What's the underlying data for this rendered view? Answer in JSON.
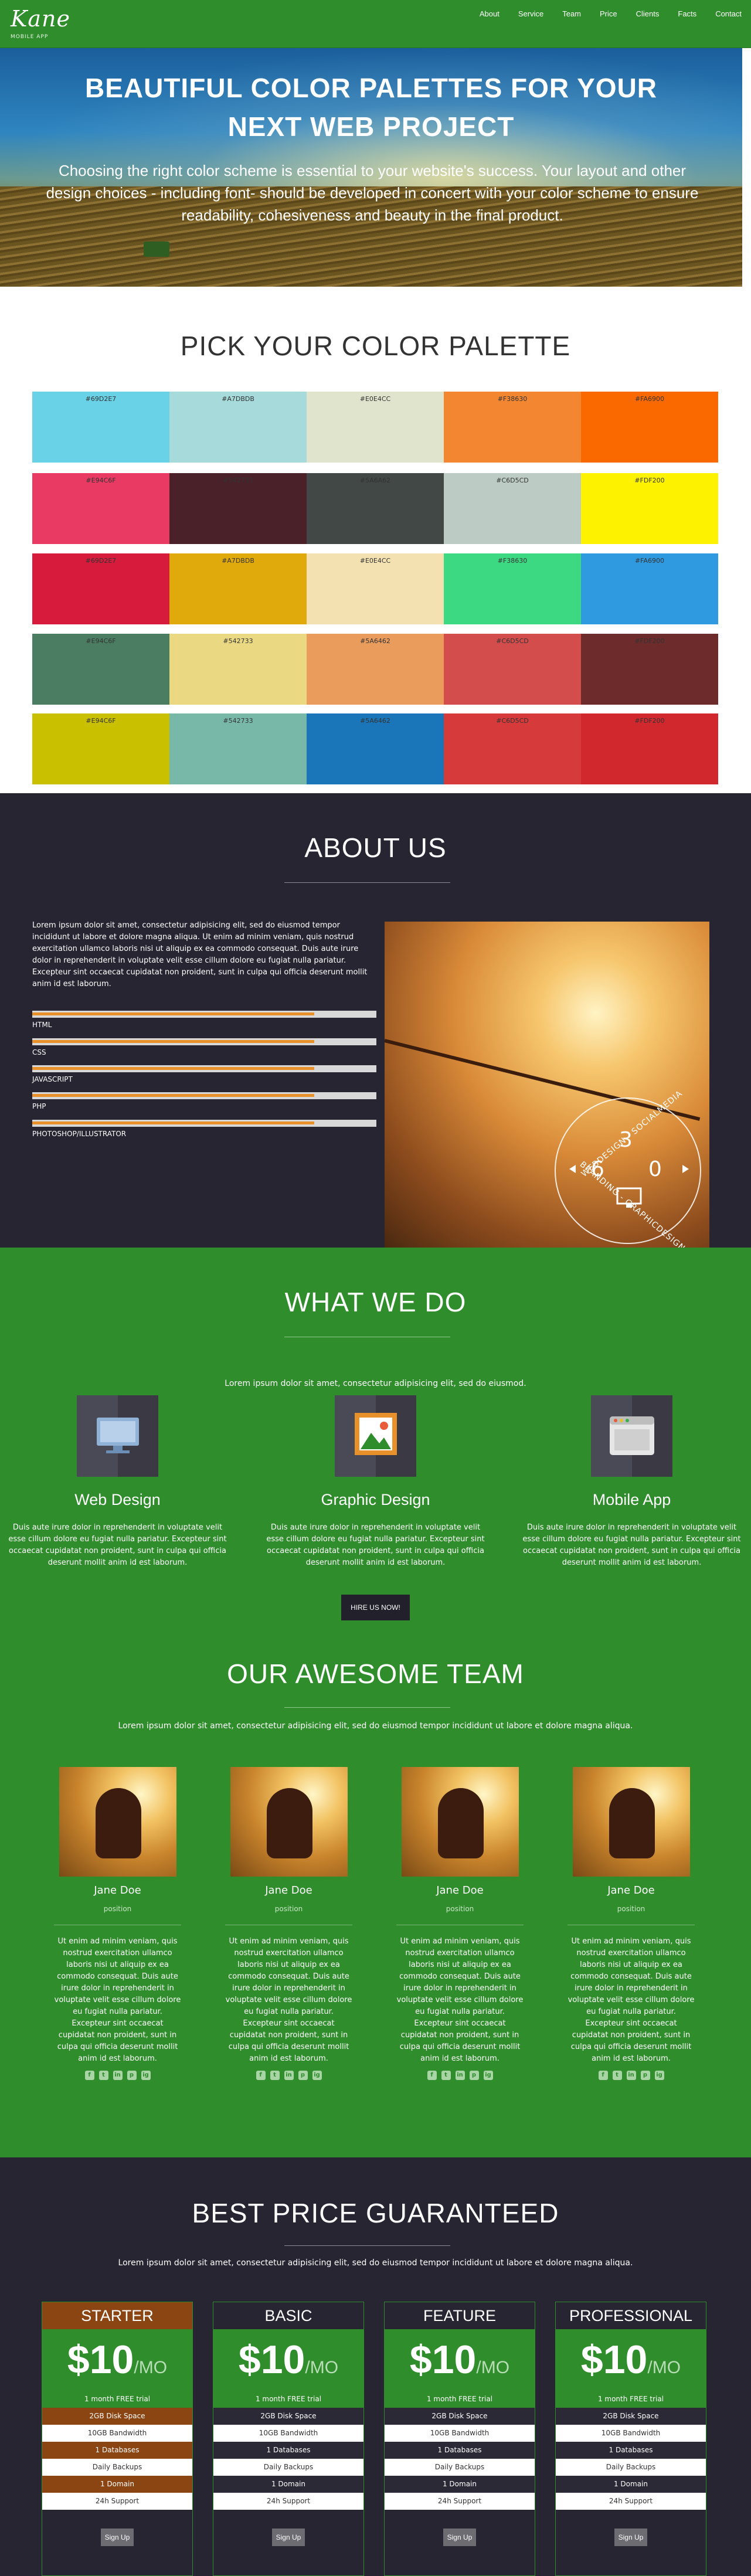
{
  "nav": {
    "logo_text": "Kane",
    "logo_sub": "MOBILE APP",
    "links": [
      "About",
      "Service",
      "Team",
      "Price",
      "Clients",
      "Facts",
      "Contact"
    ]
  },
  "hero": {
    "title": "BEAUTIFUL COLOR PALETTES FOR YOUR NEXT WEB PROJECT",
    "text": "Choosing the right color scheme is essential to your website's success. Your layout and other design choices - including font- should be developed in concert with your color scheme to ensure readability, cohesiveness and beauty in the final product."
  },
  "palettes": {
    "title": "PICK YOUR COLOR PALETTE",
    "rows": [
      [
        {
          "label": "#69D2E7",
          "color": "#69d2e7"
        },
        {
          "label": "#A7DBDB",
          "color": "#a7dbdb"
        },
        {
          "label": "#E0E4CC",
          "color": "#e0e4cc"
        },
        {
          "label": "#F38630",
          "color": "#f38630"
        },
        {
          "label": "#FA6900",
          "color": "#fa6900"
        }
      ],
      [
        {
          "label": "#E94C6F",
          "color": "#e83a63"
        },
        {
          "label": "#542733",
          "color": "#4a2029"
        },
        {
          "label": "#5A6A62",
          "color": "#414845"
        },
        {
          "label": "#C6D5CD",
          "color": "#bccbc3"
        },
        {
          "label": "#FDF200",
          "color": "#fdf200"
        }
      ],
      [
        {
          "label": "#69D2E7",
          "color": "#d61b3c"
        },
        {
          "label": "#A7DBDB",
          "color": "#e0a90c"
        },
        {
          "label": "#E0E4CC",
          "color": "#f4e1b2"
        },
        {
          "label": "#F38630",
          "color": "#3dd982"
        },
        {
          "label": "#FA6900",
          "color": "#2f9ae0"
        }
      ],
      [
        {
          "label": "#E94C6F",
          "color": "#4a7d61"
        },
        {
          "label": "#542733",
          "color": "#ead982"
        },
        {
          "label": "#5A6462",
          "color": "#ea9c5c"
        },
        {
          "label": "#C6D5CD",
          "color": "#d44d4d"
        },
        {
          "label": "#FDF200",
          "color": "#6e2b2b"
        }
      ],
      [
        {
          "label": "#E94C6F",
          "color": "#c9c000"
        },
        {
          "label": "#542733",
          "color": "#78b8a8"
        },
        {
          "label": "#5A6462",
          "color": "#1a76b8"
        },
        {
          "label": "#C6D5CD",
          "color": "#d63a3a"
        },
        {
          "label": "#FDF200",
          "color": "#d1282e"
        }
      ]
    ]
  },
  "about": {
    "title": "ABOUT US",
    "text": "Lorem ipsum dolor sit amet, consectetur adipisicing elit, sed do eiusmod tempor incididunt ut labore et dolore magna aliqua. Ut enim ad minim veniam, quis nostrud exercitation ullamco laboris nisi ut aliquip ex ea commodo consequat. Duis aute irure dolor in reprehenderit in voluptate velit esse cillum dolore eu fugiat nulla pariatur. Excepteur sint occaecat cupidatat non proident, sunt in culpa qui officia deserunt mollit anim id est laborum.",
    "skills": [
      {
        "name": "HTML",
        "level": 0.82
      },
      {
        "name": "CSS",
        "level": 0.82
      },
      {
        "name": "JAVASCRIPT",
        "level": 0.82
      },
      {
        "name": "PHP",
        "level": 0.82
      },
      {
        "name": "PHOTOSHOP/ILLUSTRATOR",
        "level": 0.82
      }
    ],
    "badge": {
      "top_text": "WEBDESIGN - SOCIALMEDIA",
      "bottom_text": "BRANDING - GRAPHICDESIGN",
      "digits": [
        "3",
        "6",
        "0"
      ]
    }
  },
  "what": {
    "title": "WHAT WE DO",
    "lead": "Lorem ipsum dolor sit amet, consectetur adipisicing elit, sed do eiusmod.",
    "services": [
      {
        "title": "Web Design",
        "icon": "monitor-icon",
        "text": "Duis aute irure dolor in reprehenderit in voluptate velit esse cillum dolore eu fugiat nulla pariatur. Excepteur sint occaecat cupidatat non proident, sunt in culpa qui officia deserunt mollit anim id est laborum."
      },
      {
        "title": "Graphic Design",
        "icon": "picture-icon",
        "text": "Duis aute irure dolor in reprehenderit in voluptate velit esse cillum dolore eu fugiat nulla pariatur. Excepteur sint occaecat cupidatat non proident, sunt in culpa qui officia deserunt mollit anim id est laborum."
      },
      {
        "title": "Mobile App",
        "icon": "browser-window-icon",
        "text": "Duis aute irure dolor in reprehenderit in voluptate velit esse cillum dolore eu fugiat nulla pariatur. Excepteur sint occaecat cupidatat non proident, sunt in culpa qui officia deserunt mollit anim id est laborum."
      }
    ],
    "hire_label": "HIRE US NOW!"
  },
  "team": {
    "title": "OUR AWESOME TEAM",
    "lead": "Lorem ipsum dolor sit amet, consectetur adipisicing elit, sed do eiusmod tempor incididunt ut labore et dolore magna aliqua.",
    "members": [
      {
        "name": "Jane Doe",
        "position": "position",
        "bio": "Ut enim ad minim veniam, quis nostrud exercitation ullamco laboris nisi ut aliquip ex ea commodo consequat. Duis aute irure dolor in reprehenderit in voluptate velit esse cillum dolore eu fugiat nulla pariatur. Excepteur sint occaecat cupidatat non proident, sunt in culpa qui officia deserunt mollit anim id est laborum."
      },
      {
        "name": "Jane Doe",
        "position": "position",
        "bio": "Ut enim ad minim veniam, quis nostrud exercitation ullamco laboris nisi ut aliquip ex ea commodo consequat. Duis aute irure dolor in reprehenderit in voluptate velit esse cillum dolore eu fugiat nulla pariatur. Excepteur sint occaecat cupidatat non proident, sunt in culpa qui officia deserunt mollit anim id est laborum."
      },
      {
        "name": "Jane Doe",
        "position": "position",
        "bio": "Ut enim ad minim veniam, quis nostrud exercitation ullamco laboris nisi ut aliquip ex ea commodo consequat. Duis aute irure dolor in reprehenderit in voluptate velit esse cillum dolore eu fugiat nulla pariatur. Excepteur sint occaecat cupidatat non proident, sunt in culpa qui officia deserunt mollit anim id est laborum."
      },
      {
        "name": "Jane Doe",
        "position": "position",
        "bio": "Ut enim ad minim veniam, quis nostrud exercitation ullamco laboris nisi ut aliquip ex ea commodo consequat. Duis aute irure dolor in reprehenderit in voluptate velit esse cillum dolore eu fugiat nulla pariatur. Excepteur sint occaecat cupidatat non proident, sunt in culpa qui officia deserunt mollit anim id est laborum."
      }
    ],
    "social_icons": [
      "facebook-icon",
      "twitter-icon",
      "linkedin-icon",
      "pinterest-icon",
      "instagram-icon"
    ]
  },
  "price": {
    "title": "BEST PRICE GUARANTEED",
    "lead": "Lorem ipsum dolor sit amet, consectetur adipisicing elit, sed do eiusmod tempor incididunt ut labore et dolore magna aliqua.",
    "plans": [
      {
        "name": "STARTER",
        "amount": "$10",
        "period": "/MO",
        "trial": "1 month FREE trial",
        "features": [
          "2GB Disk Space",
          "10GB Bandwidth",
          "1 Databases",
          "Daily Backups",
          "1 Domain",
          "24h Support"
        ],
        "signup": "Sign Up",
        "accent": "#8b4513"
      },
      {
        "name": "BASIC",
        "amount": "$10",
        "period": "/MO",
        "trial": "1 month FREE trial",
        "features": [
          "2GB Disk Space",
          "10GB Bandwidth",
          "1 Databases",
          "Daily Backups",
          "1 Domain",
          "24h Support"
        ],
        "signup": "Sign Up",
        "accent": "#272531"
      },
      {
        "name": "FEATURE",
        "amount": "$10",
        "period": "/MO",
        "trial": "1 month FREE trial",
        "features": [
          "2GB Disk Space",
          "10GB Bandwidth",
          "1 Databases",
          "Daily Backups",
          "1 Domain",
          "24h Support"
        ],
        "signup": "Sign Up",
        "accent": "#272531"
      },
      {
        "name": "PROFESSIONAL",
        "amount": "$10",
        "period": "/MO",
        "trial": "1 month FREE trial",
        "features": [
          "2GB Disk Space",
          "10GB Bandwidth",
          "1 Databases",
          "Daily Backups",
          "1 Domain",
          "24h Support"
        ],
        "signup": "Sign Up",
        "accent": "#272531"
      }
    ]
  }
}
